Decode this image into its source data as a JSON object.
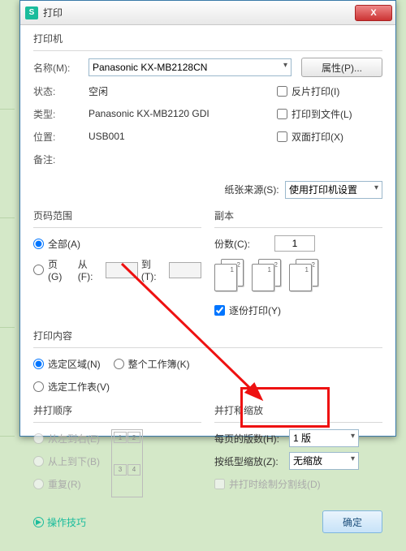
{
  "window": {
    "icon": "S",
    "title": "打印",
    "close_glyph": "X"
  },
  "printer": {
    "section": "打印机",
    "name_label": "名称(M):",
    "name_value": "Panasonic KX-MB2128CN",
    "properties_btn": "属性(P)...",
    "status_label": "状态:",
    "status_value": "空闲",
    "type_label": "类型:",
    "type_value": "Panasonic KX-MB2120 GDI",
    "where_label": "位置:",
    "where_value": "USB001",
    "comment_label": "备注:",
    "reverse_label": "反片打印(I)",
    "tofile_label": "打印到文件(L)",
    "duplex_label": "双面打印(X)"
  },
  "paper_source": {
    "label": "纸张来源(S):",
    "value": "使用打印机设置"
  },
  "range": {
    "section": "页码范围",
    "all_label": "全部(A)",
    "pages_label": "页(G)",
    "from_label": "从(F):",
    "to_label": "到(T):"
  },
  "copies": {
    "section": "副本",
    "count_label": "份数(C):",
    "count_value": "1",
    "collate_label": "逐份打印(Y)",
    "pg_front": "1",
    "pg_back": "2"
  },
  "content": {
    "section": "打印内容",
    "selection_label": "选定区域(N)",
    "workbook_label": "整个工作簿(K)",
    "sheet_label": "选定工作表(V)"
  },
  "order": {
    "section": "并打顺序",
    "lr_label": "从左到右(E)",
    "tb_label": "从上到下(B)",
    "repeat_label": "重复(R)",
    "cell1": "1",
    "cell2": "2",
    "cell3": "3",
    "cell4": "4"
  },
  "scaling": {
    "section": "并打和缩放",
    "per_page_label": "每页的版数(H):",
    "per_page_value": "1 版",
    "zoom_label": "按纸型缩放(Z):",
    "zoom_value": "无缩放",
    "borders_label": "并打时绘制分割线(D)"
  },
  "footer": {
    "tips": "操作技巧",
    "ok": "确定"
  }
}
